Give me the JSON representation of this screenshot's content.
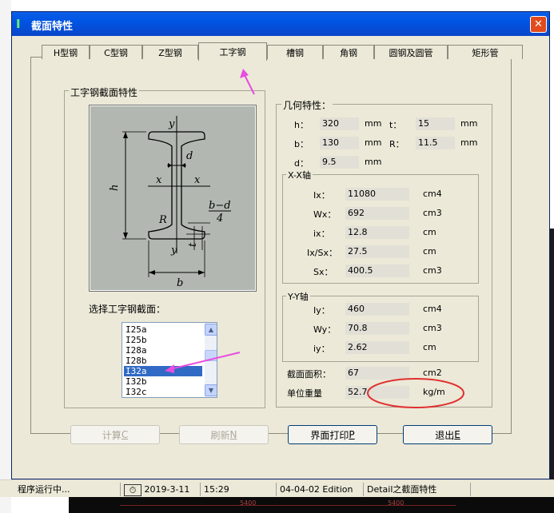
{
  "dialog": {
    "title": "截面特性"
  },
  "tabs": [
    {
      "label": "H型钢"
    },
    {
      "label": "C型钢"
    },
    {
      "label": "Z型钢"
    },
    {
      "label": "工字钢"
    },
    {
      "label": "槽钢"
    },
    {
      "label": "角钢"
    },
    {
      "label": "圆钢及圆管"
    },
    {
      "label": "矩形管"
    }
  ],
  "active_tab": "工字钢",
  "section_group": {
    "label": "工字钢截面特性"
  },
  "diagram": {
    "labels": {
      "y_top": "y",
      "y_bottom": "y",
      "x_left": "x",
      "x_right": "x",
      "h": "h",
      "d": "d",
      "R": "R",
      "t": "t",
      "b": "b",
      "frac_num": "b−d",
      "frac_den": "4"
    }
  },
  "select_label": "选择工字钢截面：",
  "section_list": {
    "items": [
      "I25a",
      "I25b",
      "I28a",
      "I28b",
      "I32a",
      "I32b",
      "I32c"
    ],
    "selected": "I32a"
  },
  "geometry": {
    "label": "几何特性：",
    "h": {
      "label": "h：",
      "value": "320",
      "unit": "mm"
    },
    "t": {
      "label": "t：",
      "value": "15",
      "unit": "mm"
    },
    "b": {
      "label": "b：",
      "value": "130",
      "unit": "mm"
    },
    "R": {
      "label": "R：",
      "value": "11.5",
      "unit": "mm"
    },
    "d": {
      "label": "d：",
      "value": "9.5",
      "unit": "mm"
    }
  },
  "xx_axis": {
    "label": "X-X轴",
    "Ix": {
      "label": "Ix：",
      "value": "11080",
      "unit": "cm4"
    },
    "Wx": {
      "label": "Wx：",
      "value": "692",
      "unit": "cm3"
    },
    "ix": {
      "label": "ix：",
      "value": "12.8",
      "unit": "cm"
    },
    "IxSx": {
      "label": "Ix/Sx：",
      "value": "27.5",
      "unit": "cm"
    },
    "Sx": {
      "label": "Sx：",
      "value": "400.5",
      "unit": "cm3"
    }
  },
  "yy_axis": {
    "label": "Y-Y轴",
    "Iy": {
      "label": "Iy：",
      "value": "460",
      "unit": "cm4"
    },
    "Wy": {
      "label": "Wy：",
      "value": "70.8",
      "unit": "cm3"
    },
    "iy": {
      "label": "iy：",
      "value": "2.62",
      "unit": "cm"
    }
  },
  "area": {
    "label": "截面面积：",
    "value": "67",
    "unit": "cm2"
  },
  "unit_weight": {
    "label": "单位重量",
    "value": "52.7",
    "unit": "kg/m"
  },
  "buttons": {
    "calc": {
      "text": "计算",
      "key": "C"
    },
    "refresh": {
      "text": "刷新",
      "key": "N"
    },
    "print": {
      "text": "界面打印",
      "key": "P"
    },
    "exit": {
      "text": "退出",
      "key": "E"
    }
  },
  "status_bar": {
    "state": "程序运行中...",
    "date": "2019-3-11",
    "time": "15:29",
    "edition": "04-04-02 Edition",
    "module": "Detail之截面特性"
  },
  "background": {
    "ruler_a": "5400",
    "ruler_b": "5400"
  },
  "colors": {
    "titlebar": "#0054e3",
    "annotation_arrow": "#e84ce0",
    "highlight_ellipse": "#e03030",
    "selection": "#316ac5",
    "field_bg": "#e2e0d6"
  }
}
